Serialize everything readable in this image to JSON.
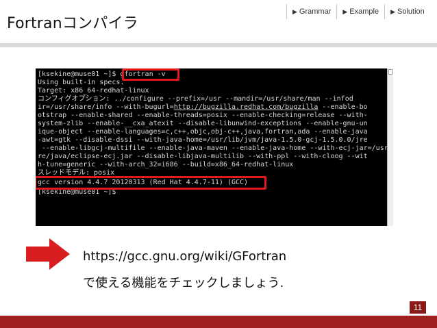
{
  "slide": {
    "title": "Fortranコンパイラ",
    "page_number": "11"
  },
  "nav": {
    "items": [
      {
        "label": "Grammar",
        "icon": "triangle-right-icon"
      },
      {
        "label": "Example",
        "icon": "triangle-right-icon"
      },
      {
        "label": "Solution",
        "icon": "triangle-right-icon"
      }
    ]
  },
  "terminal": {
    "lines": [
      "[ksekine@muse01 ~]$ gfortran -v",
      "Using built-in specs.",
      "Target: x86_64-redhat-linux",
      "コンフィグオプション: ../configure --prefix=/usr --mandir=/usr/share/man --infod",
      "ir=/usr/share/info --with-bugurl=http://bugzilla.redhat.com/bugzilla --enable-bo",
      "otstrap --enable-shared --enable-threads=posix --enable-checking=release --with-",
      "system-zlib --enable-__cxa_atexit --disable-libunwind-exceptions --enable-gnu-un",
      "ique-object --enable-languages=c,c++,objc,obj-c++,java,fortran,ada --enable-java",
      "-awt=gtk --disable-dssi --with-java-home=/usr/lib/jvm/java-1.5.0-gcj-1.5.0.0/jre",
      " --enable-libgcj-multifile --enable-java-maven --enable-java-home --with-ecj-jar=/usr/sha",
      "re/java/eclipse-ecj.jar --disable-libjava-multilib --with-ppl --with-cloog --wit",
      "h-tune=generic --with-arch_32=i686 --build=x86_64-redhat-linux",
      "スレッドモデル: posix",
      "gcc version 4.4.7 20120313 (Red Hat 4.4.7-11) (GCC)",
      "[ksekine@muse01 ~]$"
    ],
    "prompt": "[ksekine@muse01 ~]$ ",
    "command": "gfortran -v",
    "url_prefix": "ir=/usr/share/info --with-bugurl=",
    "url": "http://bugzilla.redhat.com/bugzilla",
    "url_suffix": " --enable-bo"
  },
  "body": {
    "url_text": "https://gcc.gnu.org/wiki/GFortran",
    "caption": "で使える機能をチェックしましょう."
  },
  "colors": {
    "accent": "#a01f1f",
    "highlight": "#e01a1a",
    "arrow": "#d81e1e"
  }
}
